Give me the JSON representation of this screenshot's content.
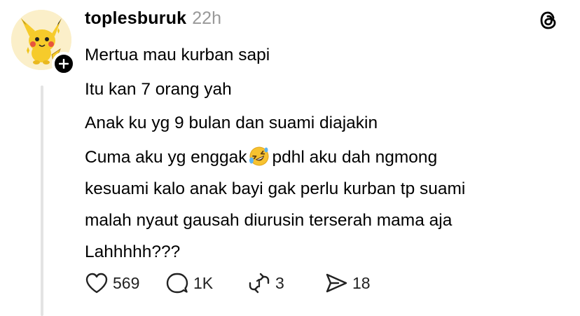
{
  "post": {
    "username": "toplesburuk",
    "timestamp": "22h",
    "lines": [
      "Mertua mau kurban sapi",
      "Itu kan 7 orang yah",
      "Anak ku yg 9 bulan dan suami diajakin",
      "Cuma aku yg enggak",
      "pdhl aku dah ngmong",
      "kesuami kalo anak bayi gak perlu kurban tp suami",
      "malah nyaut gausah diurusin terserah mama aja",
      "Lahhhhh???"
    ],
    "emoji": "rolling-on-floor-laughing-emoji"
  },
  "actions": {
    "likes": "569",
    "replies": "1K",
    "reposts": "3",
    "shares": "18"
  },
  "icons": {
    "brand": "threads-logo-icon",
    "avatar": "pikachu-avatar",
    "follow": "plus-icon",
    "like": "heart-icon",
    "reply": "comment-bubble-icon",
    "repost": "repost-arrows-icon",
    "share": "paper-plane-icon"
  },
  "colors": {
    "text": "#000000",
    "muted": "#999999",
    "thread_line": "#e3e3e3",
    "avatar_bg": "#fbefc9"
  }
}
